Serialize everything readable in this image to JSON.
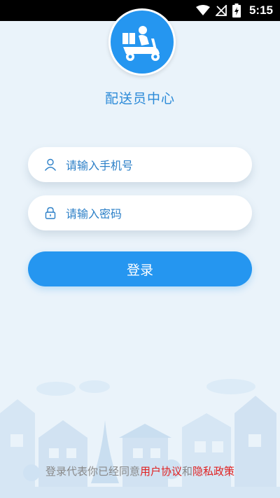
{
  "status_bar": {
    "time": "5:15"
  },
  "app": {
    "title": "配送员中心"
  },
  "form": {
    "phone_placeholder": "请输入手机号",
    "password_placeholder": "请输入密码",
    "login_label": "登录"
  },
  "agreement": {
    "prefix": "登录代表你已经同意",
    "user_agreement": "用户协议",
    "and": "和",
    "privacy_policy": "隐私政策"
  },
  "colors": {
    "primary": "#2596f0",
    "link_red": "#e02020",
    "background": "#eaf3fa"
  }
}
